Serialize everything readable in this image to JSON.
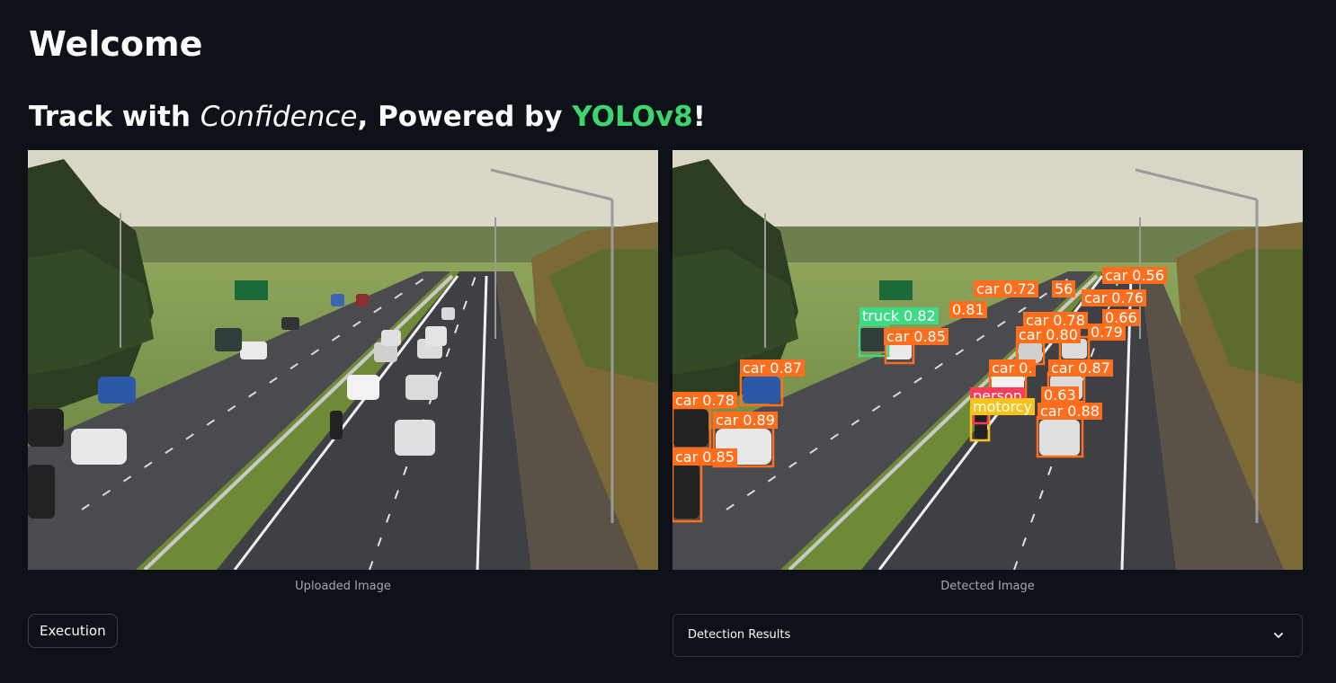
{
  "header": {
    "title": "Welcome",
    "subtitle_prefix": "Track with ",
    "subtitle_emph": "Confidence",
    "subtitle_mid": ", Powered by ",
    "subtitle_brand": "YOLOv8",
    "subtitle_suffix": "!"
  },
  "colors": {
    "background": "#0e1117",
    "brand_accent": "#3dd56d",
    "car_box": "#ff6e1c",
    "truck_box": "#3ddb86",
    "person_box": "#ff3b58",
    "motorcycle_box": "#f7c31a"
  },
  "images": {
    "uploaded_caption": "Uploaded Image",
    "detected_caption": "Detected Image"
  },
  "detections": [
    {
      "label": "car 0.56"
    },
    {
      "label": "car 0.72"
    },
    {
      "label": "56"
    },
    {
      "label": "car 0.76"
    },
    {
      "label": "truck 0.82"
    },
    {
      "label": "0.81"
    },
    {
      "label": "car 0.78"
    },
    {
      "label": "0.66"
    },
    {
      "label": "car 0.85"
    },
    {
      "label": "car 0.80"
    },
    {
      "label": "0.79"
    },
    {
      "label": "car 0.87"
    },
    {
      "label": "car 0."
    },
    {
      "label": "car 0.87"
    },
    {
      "label": "person"
    },
    {
      "label": "0.63"
    },
    {
      "label": "motorcy"
    },
    {
      "label": "car 0.78"
    },
    {
      "label": "car 0.89"
    },
    {
      "label": "car 0.88"
    },
    {
      "label": "car 0.85"
    }
  ],
  "actions": {
    "execution_label": "Execution"
  },
  "results": {
    "expander_label": "Detection Results",
    "icon": "chevron-down-icon"
  }
}
